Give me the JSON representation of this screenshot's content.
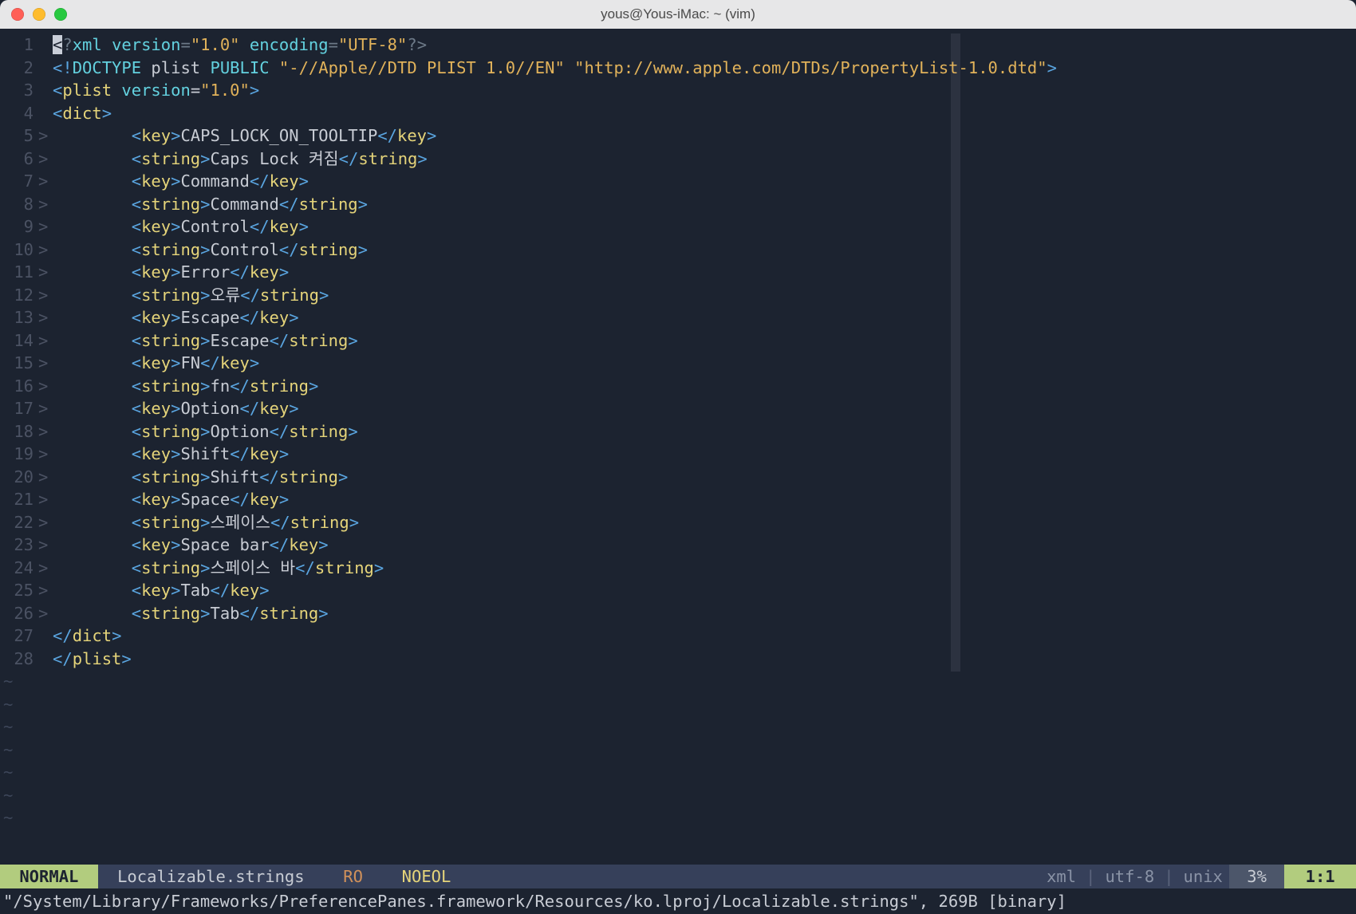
{
  "window": {
    "title": "yous@Yous-iMac: ~ (vim)"
  },
  "editor": {
    "lines": [
      {
        "n": 1,
        "fold": "",
        "html": "<span class='cursor-bg'>&lt;</span><span class='comment'>?</span><span class='cyan'>xml</span><span class='comment'> </span><span class='cyan'>version</span><span class='comment'>=</span><span class='key'>\"1.0\"</span><span class='comment'> </span><span class='cyan'>encoding</span><span class='comment'>=</span><span class='key'>\"UTF-8\"</span><span class='comment'>?&gt;</span>"
      },
      {
        "n": 2,
        "fold": "",
        "html": "<span class='tag'>&lt;!</span><span class='cyan'>DOCTYPE</span><span class='white'> plist </span><span class='cyan'>PUBLIC</span><span class='white'> </span><span class='key'>\"-//Apple//DTD PLIST 1.0//EN\"</span><span class='white'> </span><span class='key'>\"http://www.apple.com/DTDs/PropertyList-1.0.dtd\"</span><span class='tag'>&gt;</span>"
      },
      {
        "n": 3,
        "fold": "",
        "html": "<span class='tag'>&lt;</span><span class='name'>plist</span><span class='white'> </span><span class='cyan'>version</span><span class='white'>=</span><span class='key'>\"1.0\"</span><span class='tag'>&gt;</span>"
      },
      {
        "n": 4,
        "fold": "",
        "html": "<span class='tag'>&lt;</span><span class='name'>dict</span><span class='tag'>&gt;</span>"
      },
      {
        "n": 5,
        "fold": ">",
        "html": "        <span class='tag'>&lt;</span><span class='name'>key</span><span class='tag'>&gt;</span><span class='white'>CAPS_LOCK_ON_TOOLTIP</span><span class='tag'>&lt;/</span><span class='name'>key</span><span class='tag'>&gt;</span>"
      },
      {
        "n": 6,
        "fold": ">",
        "html": "        <span class='tag'>&lt;</span><span class='name'>string</span><span class='tag'>&gt;</span><span class='white'>Caps Lock 켜짐</span><span class='tag'>&lt;/</span><span class='name'>string</span><span class='tag'>&gt;</span>"
      },
      {
        "n": 7,
        "fold": ">",
        "html": "        <span class='tag'>&lt;</span><span class='name'>key</span><span class='tag'>&gt;</span><span class='white'>Command</span><span class='tag'>&lt;/</span><span class='name'>key</span><span class='tag'>&gt;</span>"
      },
      {
        "n": 8,
        "fold": ">",
        "html": "        <span class='tag'>&lt;</span><span class='name'>string</span><span class='tag'>&gt;</span><span class='white'>Command</span><span class='tag'>&lt;/</span><span class='name'>string</span><span class='tag'>&gt;</span>"
      },
      {
        "n": 9,
        "fold": ">",
        "html": "        <span class='tag'>&lt;</span><span class='name'>key</span><span class='tag'>&gt;</span><span class='white'>Control</span><span class='tag'>&lt;/</span><span class='name'>key</span><span class='tag'>&gt;</span>"
      },
      {
        "n": 10,
        "fold": ">",
        "html": "        <span class='tag'>&lt;</span><span class='name'>string</span><span class='tag'>&gt;</span><span class='white'>Control</span><span class='tag'>&lt;/</span><span class='name'>string</span><span class='tag'>&gt;</span>"
      },
      {
        "n": 11,
        "fold": ">",
        "html": "        <span class='tag'>&lt;</span><span class='name'>key</span><span class='tag'>&gt;</span><span class='white'>Error</span><span class='tag'>&lt;/</span><span class='name'>key</span><span class='tag'>&gt;</span>"
      },
      {
        "n": 12,
        "fold": ">",
        "html": "        <span class='tag'>&lt;</span><span class='name'>string</span><span class='tag'>&gt;</span><span class='white'>오류</span><span class='tag'>&lt;/</span><span class='name'>string</span><span class='tag'>&gt;</span>"
      },
      {
        "n": 13,
        "fold": ">",
        "html": "        <span class='tag'>&lt;</span><span class='name'>key</span><span class='tag'>&gt;</span><span class='white'>Escape</span><span class='tag'>&lt;/</span><span class='name'>key</span><span class='tag'>&gt;</span>"
      },
      {
        "n": 14,
        "fold": ">",
        "html": "        <span class='tag'>&lt;</span><span class='name'>string</span><span class='tag'>&gt;</span><span class='white'>Escape</span><span class='tag'>&lt;/</span><span class='name'>string</span><span class='tag'>&gt;</span>"
      },
      {
        "n": 15,
        "fold": ">",
        "html": "        <span class='tag'>&lt;</span><span class='name'>key</span><span class='tag'>&gt;</span><span class='white'>FN</span><span class='tag'>&lt;/</span><span class='name'>key</span><span class='tag'>&gt;</span>"
      },
      {
        "n": 16,
        "fold": ">",
        "html": "        <span class='tag'>&lt;</span><span class='name'>string</span><span class='tag'>&gt;</span><span class='white'>fn</span><span class='tag'>&lt;/</span><span class='name'>string</span><span class='tag'>&gt;</span>"
      },
      {
        "n": 17,
        "fold": ">",
        "html": "        <span class='tag'>&lt;</span><span class='name'>key</span><span class='tag'>&gt;</span><span class='white'>Option</span><span class='tag'>&lt;/</span><span class='name'>key</span><span class='tag'>&gt;</span>"
      },
      {
        "n": 18,
        "fold": ">",
        "html": "        <span class='tag'>&lt;</span><span class='name'>string</span><span class='tag'>&gt;</span><span class='white'>Option</span><span class='tag'>&lt;/</span><span class='name'>string</span><span class='tag'>&gt;</span>"
      },
      {
        "n": 19,
        "fold": ">",
        "html": "        <span class='tag'>&lt;</span><span class='name'>key</span><span class='tag'>&gt;</span><span class='white'>Shift</span><span class='tag'>&lt;/</span><span class='name'>key</span><span class='tag'>&gt;</span>"
      },
      {
        "n": 20,
        "fold": ">",
        "html": "        <span class='tag'>&lt;</span><span class='name'>string</span><span class='tag'>&gt;</span><span class='white'>Shift</span><span class='tag'>&lt;/</span><span class='name'>string</span><span class='tag'>&gt;</span>"
      },
      {
        "n": 21,
        "fold": ">",
        "html": "        <span class='tag'>&lt;</span><span class='name'>key</span><span class='tag'>&gt;</span><span class='white'>Space</span><span class='tag'>&lt;/</span><span class='name'>key</span><span class='tag'>&gt;</span>"
      },
      {
        "n": 22,
        "fold": ">",
        "html": "        <span class='tag'>&lt;</span><span class='name'>string</span><span class='tag'>&gt;</span><span class='white'>스페이스</span><span class='tag'>&lt;/</span><span class='name'>string</span><span class='tag'>&gt;</span>"
      },
      {
        "n": 23,
        "fold": ">",
        "html": "        <span class='tag'>&lt;</span><span class='name'>key</span><span class='tag'>&gt;</span><span class='white'>Space bar</span><span class='tag'>&lt;/</span><span class='name'>key</span><span class='tag'>&gt;</span>"
      },
      {
        "n": 24,
        "fold": ">",
        "html": "        <span class='tag'>&lt;</span><span class='name'>string</span><span class='tag'>&gt;</span><span class='white'>스페이스 바</span><span class='tag'>&lt;/</span><span class='name'>string</span><span class='tag'>&gt;</span>"
      },
      {
        "n": 25,
        "fold": ">",
        "html": "        <span class='tag'>&lt;</span><span class='name'>key</span><span class='tag'>&gt;</span><span class='white'>Tab</span><span class='tag'>&lt;/</span><span class='name'>key</span><span class='tag'>&gt;</span>"
      },
      {
        "n": 26,
        "fold": ">",
        "html": "        <span class='tag'>&lt;</span><span class='name'>string</span><span class='tag'>&gt;</span><span class='white'>Tab</span><span class='tag'>&lt;/</span><span class='name'>string</span><span class='tag'>&gt;</span>"
      },
      {
        "n": 27,
        "fold": "",
        "html": "<span class='tag'>&lt;/</span><span class='name'>dict</span><span class='tag'>&gt;</span>"
      },
      {
        "n": 28,
        "fold": "",
        "html": "<span class='tag'>&lt;/</span><span class='name'>plist</span><span class='tag'>&gt;</span>"
      }
    ],
    "tilde_rows": 7
  },
  "status": {
    "mode": " NORMAL ",
    "file": " Localizable.strings ",
    "ro": " RO ",
    "noeol": " NOEOL ",
    "filetype": "xml",
    "encoding": "utf-8",
    "platform": "unix",
    "percent": " 3% ",
    "pos": " 1:1 "
  },
  "cmdline": "\"/System/Library/Frameworks/PreferencePanes.framework/Resources/ko.lproj/Localizable.strings\", 269B [binary]"
}
